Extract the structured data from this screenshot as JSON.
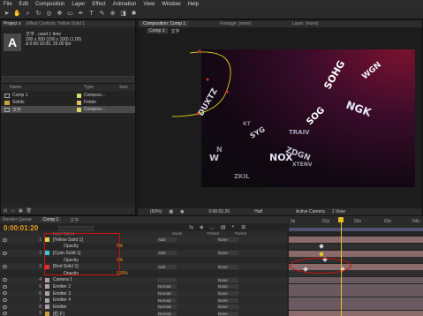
{
  "menu": [
    "File",
    "Edit",
    "Composition",
    "Layer",
    "Effect",
    "Animation",
    "View",
    "Window",
    "Help"
  ],
  "toolbar": {
    "icons": [
      "selection-tool",
      "hand-tool",
      "zoom-tool",
      "rotate-tool",
      "camera-tool",
      "pan-behind-tool",
      "rectangle-tool",
      "pen-tool",
      "text-tool",
      "brush-tool",
      "clone-tool",
      "eraser-tool",
      "puppet-tool"
    ]
  },
  "project": {
    "tabs": [
      "Project ≡",
      "Effect Controls: Yellow Solid 1"
    ],
    "thumb_letter": "A",
    "info_lines": [
      "文字 , used 1 time",
      "200 x 200 (100 x 100) (1.00)",
      "Δ 0:00:10:00, 25.00 fps"
    ],
    "columns": [
      "Name",
      "Type",
      "Size"
    ],
    "items": [
      {
        "name": "Comp 1",
        "type": "Composi…",
        "color": "#d8d86a"
      },
      {
        "name": "Solids",
        "type": "Folder",
        "color": "#e0c060"
      },
      {
        "name": "文字",
        "type": "Composi…",
        "color": "#d8d86a"
      }
    ]
  },
  "viewer": {
    "tabs": [
      "Composition: Comp 1",
      "Footage: (none)",
      "Layer: (none)"
    ],
    "comp_tabs": [
      "Comp 1",
      "文字"
    ],
    "bottom": {
      "zoom": "(50%)",
      "time": "0:00:01:20",
      "res": "Half",
      "camera": "Active Camera",
      "view": "1 View"
    }
  },
  "timeline": {
    "tabs": [
      "Render Queue",
      "Comp 1",
      "文字"
    ],
    "timecode": "0:00:01:20",
    "columns": {
      "source": "Layer Name",
      "mode": "Mode",
      "trkmat": "TrkMat",
      "parent": "Parent"
    },
    "ruler": [
      "0s",
      "01s",
      "02s",
      "03s",
      "04s"
    ],
    "layers": [
      {
        "num": "1",
        "name": "[Yellow Solid 1]",
        "mode": "Add",
        "parent": "None",
        "color": "#d8d84a",
        "kind": "layer"
      },
      {
        "num": "",
        "name": "Opacity",
        "value": "0%",
        "kind": "prop"
      },
      {
        "num": "2",
        "name": "[Cyan Solid 1]",
        "mode": "Add",
        "parent": "None",
        "color": "#30c8e0",
        "kind": "layer"
      },
      {
        "num": "",
        "name": "Opacity",
        "value": "0%",
        "kind": "prop"
      },
      {
        "num": "3",
        "name": "[Red Solid 1]",
        "mode": "Add",
        "parent": "None",
        "color": "#e03030",
        "kind": "layer"
      },
      {
        "num": "",
        "name": "Opacity",
        "value": "100%",
        "kind": "prop"
      },
      {
        "num": "4",
        "name": "Camera 1",
        "mode": "",
        "parent": "None",
        "color": "#b0a0b0",
        "kind": "layer"
      },
      {
        "num": "5",
        "name": "Emitter 2",
        "mode": "Normal",
        "parent": "None",
        "color": "#b0a0b0",
        "kind": "layer"
      },
      {
        "num": "6",
        "name": "Emitter 3",
        "mode": "Normal",
        "parent": "None",
        "color": "#b0a0b0",
        "kind": "layer"
      },
      {
        "num": "7",
        "name": "Emitter 4",
        "mode": "Normal",
        "parent": "None",
        "color": "#b0a0b0",
        "kind": "layer"
      },
      {
        "num": "8",
        "name": "Emitter",
        "mode": "Normal",
        "parent": "None",
        "color": "#b0a0b0",
        "kind": "layer"
      },
      {
        "num": "9",
        "name": "[粒子]",
        "mode": "Normal",
        "parent": "None",
        "color": "#c8a040",
        "kind": "layer"
      }
    ]
  },
  "colors": {
    "accent": "#d01010",
    "playhead": "#e8c020",
    "bg": "#232323"
  }
}
